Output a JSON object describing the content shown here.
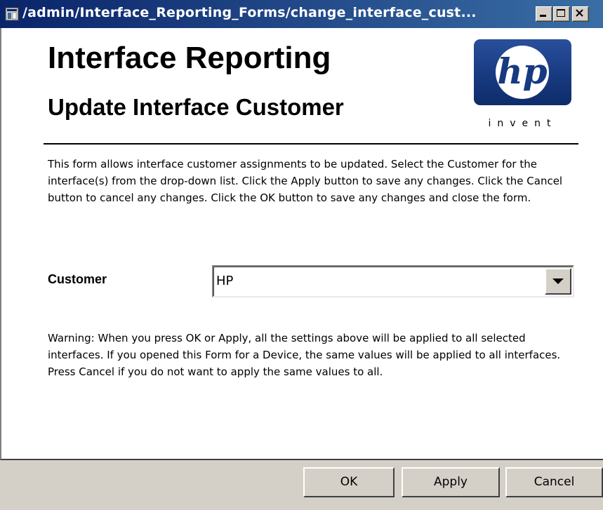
{
  "window": {
    "title": "/admin/Interface_Reporting_Forms/change_interface_cust...",
    "icon": "form-window-icon",
    "controls": {
      "minimize": "minimize-icon",
      "maximize": "maximize-icon",
      "close": "close-icon"
    }
  },
  "header": {
    "title": "Interface Reporting",
    "subtitle": "Update Interface Customer",
    "logo_text": "invent",
    "logo_brand": "hp"
  },
  "intro_text": "This form allows interface customer assignments to be updated. Select the Customer for the interface(s) from the drop-down list. Click the Apply button to save any changes. Click the Cancel button to cancel any changes. Click the OK button to save any changes and close the form.",
  "form": {
    "customer_label": "Customer",
    "customer_value": "HP"
  },
  "warning_text": "Warning: When you press OK or Apply, all the settings above will be applied to all selected interfaces. If you opened this Form for a Device, the same values will be applied to all interfaces. Press Cancel if you do not want to apply the same values to all.",
  "buttons": {
    "ok": "OK",
    "apply": "Apply",
    "cancel": "Cancel"
  },
  "colors": {
    "titlebar_start": "#0a246a",
    "titlebar_end": "#3a6ea5",
    "logo_blue": "#173a80",
    "chrome_gray": "#d4d0c8"
  }
}
